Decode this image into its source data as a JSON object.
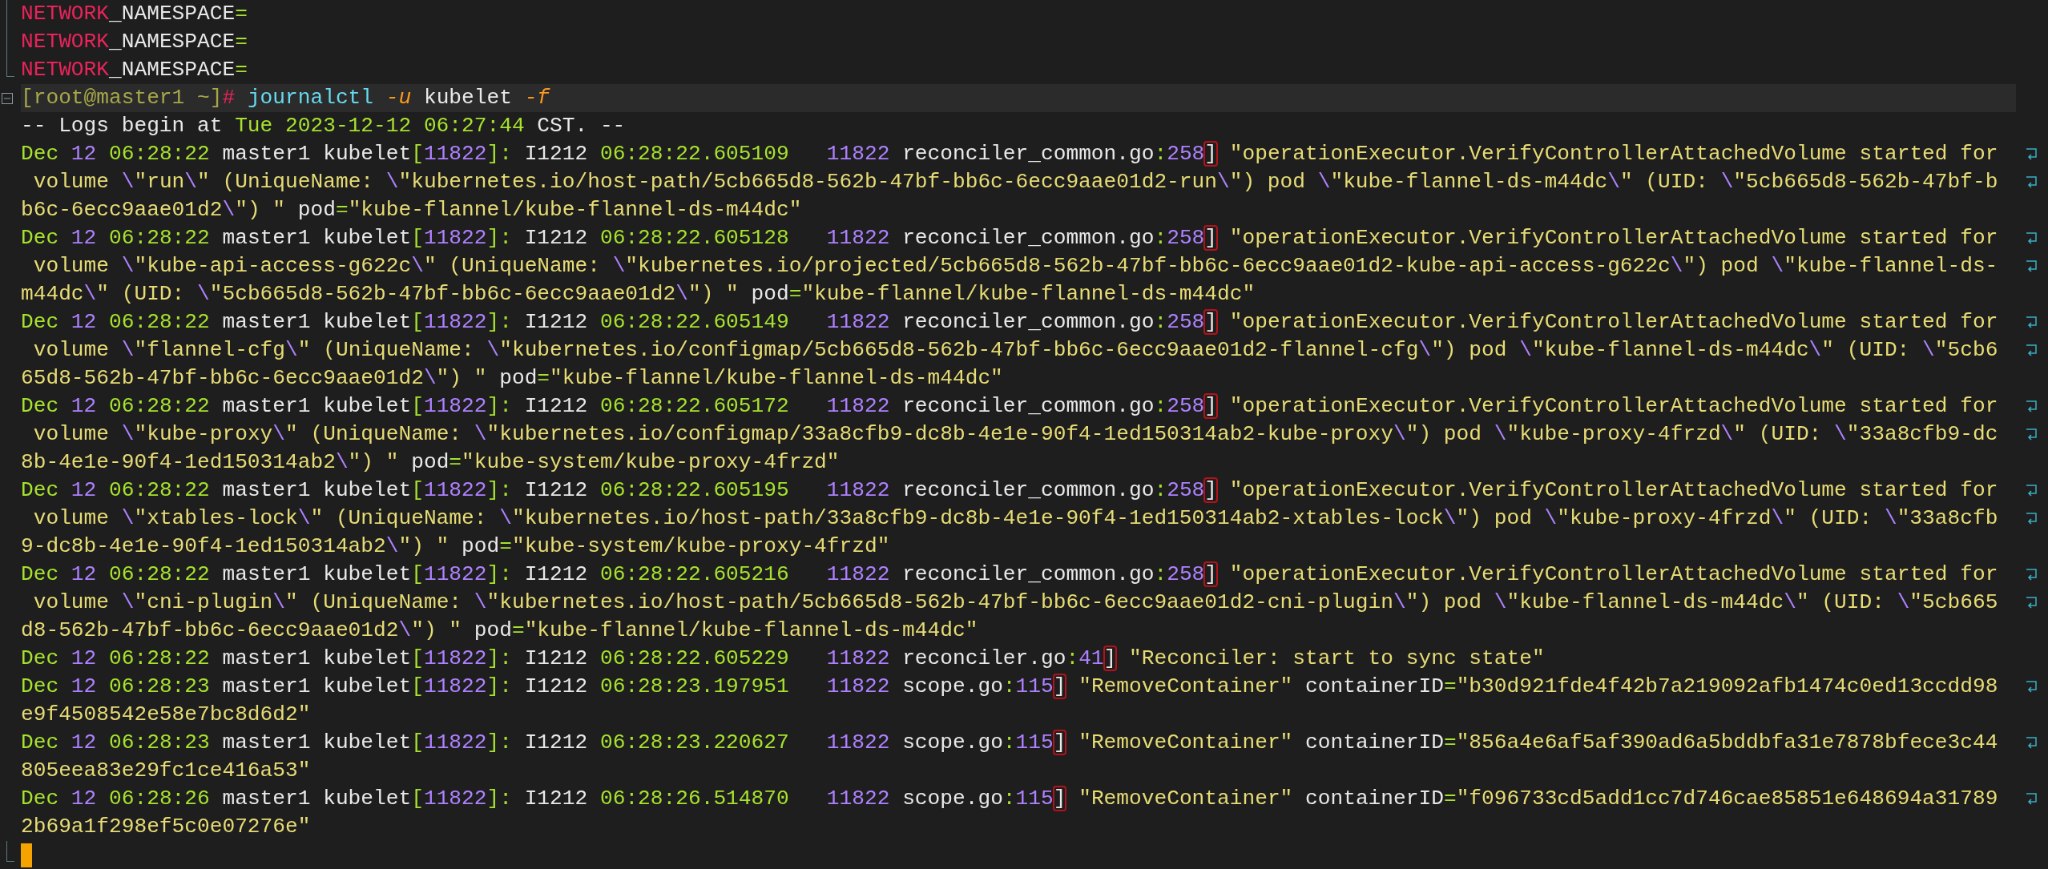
{
  "terminal": {
    "lines": [
      {
        "kind": "branch",
        "current": false,
        "wrapped": false,
        "segments": [
          {
            "kind": "keyword",
            "text": "NETWORK"
          },
          {
            "kind": "plain",
            "text": "_NAMESPACE"
          },
          {
            "kind": "punct",
            "text": "="
          }
        ]
      },
      {
        "kind": "branch",
        "current": false,
        "wrapped": false,
        "segments": [
          {
            "kind": "keyword",
            "text": "NETWORK"
          },
          {
            "kind": "plain",
            "text": "_NAMESPACE"
          },
          {
            "kind": "punct",
            "text": "="
          }
        ]
      },
      {
        "kind": "last",
        "current": false,
        "wrapped": false,
        "segments": [
          {
            "kind": "keyword",
            "text": "NETWORK"
          },
          {
            "kind": "plain",
            "text": "_NAMESPACE"
          },
          {
            "kind": "punct",
            "text": "="
          }
        ]
      },
      {
        "kind": "fold",
        "current": true,
        "wrapped": false,
        "segments": [
          {
            "kind": "prompt",
            "text": "[root@master1 ~]"
          },
          {
            "kind": "keyword",
            "text": "#"
          },
          {
            "kind": "command",
            "text": " journalctl"
          },
          {
            "kind": "flag",
            "text": " -u"
          },
          {
            "kind": "plain",
            "text": " kubelet"
          },
          {
            "kind": "flag",
            "text": " -f"
          }
        ]
      },
      {
        "current": false,
        "wrapped": false,
        "segments": [
          {
            "kind": "plain",
            "text": "-- Logs begin at "
          },
          {
            "kind": "time",
            "text": "Tue 2023-12-12 06:27:44"
          },
          {
            "kind": "plain",
            "text": " CST. --"
          }
        ]
      },
      {
        "current": false,
        "wrapped": true,
        "segments": [
          {
            "kind": "time",
            "text": "Dec"
          },
          {
            "kind": "number",
            "text": " 12"
          },
          {
            "kind": "time",
            "text": " 06:28:22"
          },
          {
            "kind": "plain",
            "text": " master1 kubelet"
          },
          {
            "kind": "punct",
            "text": "["
          },
          {
            "kind": "number",
            "text": "11822"
          },
          {
            "kind": "punct",
            "text": "]:"
          },
          {
            "kind": "plain",
            "text": " I1212 "
          },
          {
            "kind": "time",
            "text": "06:28:22.605109"
          },
          {
            "kind": "number",
            "text": "   11822"
          },
          {
            "kind": "plain",
            "text": " reconciler_common.go"
          },
          {
            "kind": "punct",
            "text": ":"
          },
          {
            "kind": "number",
            "text": "258"
          },
          {
            "kind": "match",
            "text": "]"
          },
          {
            "kind": "string",
            "text": " \"operationExecutor.VerifyControllerAttachedVolume started for"
          }
        ]
      },
      {
        "current": false,
        "wrapped": true,
        "segments": [
          {
            "kind": "string",
            "text": " volume "
          },
          {
            "kind": "escape",
            "text": "\\"
          },
          {
            "kind": "string",
            "text": "\"run"
          },
          {
            "kind": "escape",
            "text": "\\"
          },
          {
            "kind": "string",
            "text": "\" (UniqueName: "
          },
          {
            "kind": "escape",
            "text": "\\"
          },
          {
            "kind": "string",
            "text": "\"kubernetes.io/host-path/5cb665d8-562b-47bf-bb6c-6ecc9aae01d2-run"
          },
          {
            "kind": "escape",
            "text": "\\"
          },
          {
            "kind": "string",
            "text": "\") pod "
          },
          {
            "kind": "escape",
            "text": "\\"
          },
          {
            "kind": "string",
            "text": "\"kube-flannel-ds-m44dc"
          },
          {
            "kind": "escape",
            "text": "\\"
          },
          {
            "kind": "string",
            "text": "\" (UID: "
          },
          {
            "kind": "escape",
            "text": "\\"
          },
          {
            "kind": "string",
            "text": "\"5cb665d8-562b-47bf-b"
          }
        ]
      },
      {
        "current": false,
        "wrapped": false,
        "segments": [
          {
            "kind": "string",
            "text": "b6c-6ecc9aae01d2"
          },
          {
            "kind": "escape",
            "text": "\\"
          },
          {
            "kind": "string",
            "text": "\") \""
          },
          {
            "kind": "plain",
            "text": " pod"
          },
          {
            "kind": "punct",
            "text": "="
          },
          {
            "kind": "string",
            "text": "\"kube-flannel/kube-flannel-ds-m44dc\""
          }
        ]
      },
      {
        "current": false,
        "wrapped": true,
        "segments": [
          {
            "kind": "time",
            "text": "Dec"
          },
          {
            "kind": "number",
            "text": " 12"
          },
          {
            "kind": "time",
            "text": " 06:28:22"
          },
          {
            "kind": "plain",
            "text": " master1 kubelet"
          },
          {
            "kind": "punct",
            "text": "["
          },
          {
            "kind": "number",
            "text": "11822"
          },
          {
            "kind": "punct",
            "text": "]:"
          },
          {
            "kind": "plain",
            "text": " I1212 "
          },
          {
            "kind": "time",
            "text": "06:28:22.605128"
          },
          {
            "kind": "number",
            "text": "   11822"
          },
          {
            "kind": "plain",
            "text": " reconciler_common.go"
          },
          {
            "kind": "punct",
            "text": ":"
          },
          {
            "kind": "number",
            "text": "258"
          },
          {
            "kind": "match",
            "text": "]"
          },
          {
            "kind": "string",
            "text": " \"operationExecutor.VerifyControllerAttachedVolume started for"
          }
        ]
      },
      {
        "current": false,
        "wrapped": true,
        "segments": [
          {
            "kind": "string",
            "text": " volume "
          },
          {
            "kind": "escape",
            "text": "\\"
          },
          {
            "kind": "string",
            "text": "\"kube-api-access-g622c"
          },
          {
            "kind": "escape",
            "text": "\\"
          },
          {
            "kind": "string",
            "text": "\" (UniqueName: "
          },
          {
            "kind": "escape",
            "text": "\\"
          },
          {
            "kind": "string",
            "text": "\"kubernetes.io/projected/5cb665d8-562b-47bf-bb6c-6ecc9aae01d2-kube-api-access-g622c"
          },
          {
            "kind": "escape",
            "text": "\\"
          },
          {
            "kind": "string",
            "text": "\") pod "
          },
          {
            "kind": "escape",
            "text": "\\"
          },
          {
            "kind": "string",
            "text": "\"kube-flannel-ds-"
          }
        ]
      },
      {
        "current": false,
        "wrapped": false,
        "segments": [
          {
            "kind": "string",
            "text": "m44dc"
          },
          {
            "kind": "escape",
            "text": "\\"
          },
          {
            "kind": "string",
            "text": "\" (UID: "
          },
          {
            "kind": "escape",
            "text": "\\"
          },
          {
            "kind": "string",
            "text": "\"5cb665d8-562b-47bf-bb6c-6ecc9aae01d2"
          },
          {
            "kind": "escape",
            "text": "\\"
          },
          {
            "kind": "string",
            "text": "\") \""
          },
          {
            "kind": "plain",
            "text": " pod"
          },
          {
            "kind": "punct",
            "text": "="
          },
          {
            "kind": "string",
            "text": "\"kube-flannel/kube-flannel-ds-m44dc\""
          }
        ]
      },
      {
        "current": false,
        "wrapped": true,
        "segments": [
          {
            "kind": "time",
            "text": "Dec"
          },
          {
            "kind": "number",
            "text": " 12"
          },
          {
            "kind": "time",
            "text": " 06:28:22"
          },
          {
            "kind": "plain",
            "text": " master1 kubelet"
          },
          {
            "kind": "punct",
            "text": "["
          },
          {
            "kind": "number",
            "text": "11822"
          },
          {
            "kind": "punct",
            "text": "]:"
          },
          {
            "kind": "plain",
            "text": " I1212 "
          },
          {
            "kind": "time",
            "text": "06:28:22.605149"
          },
          {
            "kind": "number",
            "text": "   11822"
          },
          {
            "kind": "plain",
            "text": " reconciler_common.go"
          },
          {
            "kind": "punct",
            "text": ":"
          },
          {
            "kind": "number",
            "text": "258"
          },
          {
            "kind": "match",
            "text": "]"
          },
          {
            "kind": "string",
            "text": " \"operationExecutor.VerifyControllerAttachedVolume started for"
          }
        ]
      },
      {
        "current": false,
        "wrapped": true,
        "segments": [
          {
            "kind": "string",
            "text": " volume "
          },
          {
            "kind": "escape",
            "text": "\\"
          },
          {
            "kind": "string",
            "text": "\"flannel-cfg"
          },
          {
            "kind": "escape",
            "text": "\\"
          },
          {
            "kind": "string",
            "text": "\" (UniqueName: "
          },
          {
            "kind": "escape",
            "text": "\\"
          },
          {
            "kind": "string",
            "text": "\"kubernetes.io/configmap/5cb665d8-562b-47bf-bb6c-6ecc9aae01d2-flannel-cfg"
          },
          {
            "kind": "escape",
            "text": "\\"
          },
          {
            "kind": "string",
            "text": "\") pod "
          },
          {
            "kind": "escape",
            "text": "\\"
          },
          {
            "kind": "string",
            "text": "\"kube-flannel-ds-m44dc"
          },
          {
            "kind": "escape",
            "text": "\\"
          },
          {
            "kind": "string",
            "text": "\" (UID: "
          },
          {
            "kind": "escape",
            "text": "\\"
          },
          {
            "kind": "string",
            "text": "\"5cb6"
          }
        ]
      },
      {
        "current": false,
        "wrapped": false,
        "segments": [
          {
            "kind": "string",
            "text": "65d8-562b-47bf-bb6c-6ecc9aae01d2"
          },
          {
            "kind": "escape",
            "text": "\\"
          },
          {
            "kind": "string",
            "text": "\") \""
          },
          {
            "kind": "plain",
            "text": " pod"
          },
          {
            "kind": "punct",
            "text": "="
          },
          {
            "kind": "string",
            "text": "\"kube-flannel/kube-flannel-ds-m44dc\""
          }
        ]
      },
      {
        "current": false,
        "wrapped": true,
        "segments": [
          {
            "kind": "time",
            "text": "Dec"
          },
          {
            "kind": "number",
            "text": " 12"
          },
          {
            "kind": "time",
            "text": " 06:28:22"
          },
          {
            "kind": "plain",
            "text": " master1 kubelet"
          },
          {
            "kind": "punct",
            "text": "["
          },
          {
            "kind": "number",
            "text": "11822"
          },
          {
            "kind": "punct",
            "text": "]:"
          },
          {
            "kind": "plain",
            "text": " I1212 "
          },
          {
            "kind": "time",
            "text": "06:28:22.605172"
          },
          {
            "kind": "number",
            "text": "   11822"
          },
          {
            "kind": "plain",
            "text": " reconciler_common.go"
          },
          {
            "kind": "punct",
            "text": ":"
          },
          {
            "kind": "number",
            "text": "258"
          },
          {
            "kind": "match",
            "text": "]"
          },
          {
            "kind": "string",
            "text": " \"operationExecutor.VerifyControllerAttachedVolume started for"
          }
        ]
      },
      {
        "current": false,
        "wrapped": true,
        "segments": [
          {
            "kind": "string",
            "text": " volume "
          },
          {
            "kind": "escape",
            "text": "\\"
          },
          {
            "kind": "string",
            "text": "\"kube-proxy"
          },
          {
            "kind": "escape",
            "text": "\\"
          },
          {
            "kind": "string",
            "text": "\" (UniqueName: "
          },
          {
            "kind": "escape",
            "text": "\\"
          },
          {
            "kind": "string",
            "text": "\"kubernetes.io/configmap/33a8cfb9-dc8b-4e1e-90f4-1ed150314ab2-kube-proxy"
          },
          {
            "kind": "escape",
            "text": "\\"
          },
          {
            "kind": "string",
            "text": "\") pod "
          },
          {
            "kind": "escape",
            "text": "\\"
          },
          {
            "kind": "string",
            "text": "\"kube-proxy-4frzd"
          },
          {
            "kind": "escape",
            "text": "\\"
          },
          {
            "kind": "string",
            "text": "\" (UID: "
          },
          {
            "kind": "escape",
            "text": "\\"
          },
          {
            "kind": "string",
            "text": "\"33a8cfb9-dc"
          }
        ]
      },
      {
        "current": false,
        "wrapped": false,
        "segments": [
          {
            "kind": "string",
            "text": "8b-4e1e-90f4-1ed150314ab2"
          },
          {
            "kind": "escape",
            "text": "\\"
          },
          {
            "kind": "string",
            "text": "\") \""
          },
          {
            "kind": "plain",
            "text": " pod"
          },
          {
            "kind": "punct",
            "text": "="
          },
          {
            "kind": "string",
            "text": "\"kube-system/kube-proxy-4frzd\""
          }
        ]
      },
      {
        "current": false,
        "wrapped": true,
        "segments": [
          {
            "kind": "time",
            "text": "Dec"
          },
          {
            "kind": "number",
            "text": " 12"
          },
          {
            "kind": "time",
            "text": " 06:28:22"
          },
          {
            "kind": "plain",
            "text": " master1 kubelet"
          },
          {
            "kind": "punct",
            "text": "["
          },
          {
            "kind": "number",
            "text": "11822"
          },
          {
            "kind": "punct",
            "text": "]:"
          },
          {
            "kind": "plain",
            "text": " I1212 "
          },
          {
            "kind": "time",
            "text": "06:28:22.605195"
          },
          {
            "kind": "number",
            "text": "   11822"
          },
          {
            "kind": "plain",
            "text": " reconciler_common.go"
          },
          {
            "kind": "punct",
            "text": ":"
          },
          {
            "kind": "number",
            "text": "258"
          },
          {
            "kind": "match",
            "text": "]"
          },
          {
            "kind": "string",
            "text": " \"operationExecutor.VerifyControllerAttachedVolume started for"
          }
        ]
      },
      {
        "current": false,
        "wrapped": true,
        "segments": [
          {
            "kind": "string",
            "text": " volume "
          },
          {
            "kind": "escape",
            "text": "\\"
          },
          {
            "kind": "string",
            "text": "\"xtables-lock"
          },
          {
            "kind": "escape",
            "text": "\\"
          },
          {
            "kind": "string",
            "text": "\" (UniqueName: "
          },
          {
            "kind": "escape",
            "text": "\\"
          },
          {
            "kind": "string",
            "text": "\"kubernetes.io/host-path/33a8cfb9-dc8b-4e1e-90f4-1ed150314ab2-xtables-lock"
          },
          {
            "kind": "escape",
            "text": "\\"
          },
          {
            "kind": "string",
            "text": "\") pod "
          },
          {
            "kind": "escape",
            "text": "\\"
          },
          {
            "kind": "string",
            "text": "\"kube-proxy-4frzd"
          },
          {
            "kind": "escape",
            "text": "\\"
          },
          {
            "kind": "string",
            "text": "\" (UID: "
          },
          {
            "kind": "escape",
            "text": "\\"
          },
          {
            "kind": "string",
            "text": "\"33a8cfb"
          }
        ]
      },
      {
        "current": false,
        "wrapped": false,
        "segments": [
          {
            "kind": "string",
            "text": "9-dc8b-4e1e-90f4-1ed150314ab2"
          },
          {
            "kind": "escape",
            "text": "\\"
          },
          {
            "kind": "string",
            "text": "\") \""
          },
          {
            "kind": "plain",
            "text": " pod"
          },
          {
            "kind": "punct",
            "text": "="
          },
          {
            "kind": "string",
            "text": "\"kube-system/kube-proxy-4frzd\""
          }
        ]
      },
      {
        "current": false,
        "wrapped": true,
        "segments": [
          {
            "kind": "time",
            "text": "Dec"
          },
          {
            "kind": "number",
            "text": " 12"
          },
          {
            "kind": "time",
            "text": " 06:28:22"
          },
          {
            "kind": "plain",
            "text": " master1 kubelet"
          },
          {
            "kind": "punct",
            "text": "["
          },
          {
            "kind": "number",
            "text": "11822"
          },
          {
            "kind": "punct",
            "text": "]:"
          },
          {
            "kind": "plain",
            "text": " I1212 "
          },
          {
            "kind": "time",
            "text": "06:28:22.605216"
          },
          {
            "kind": "number",
            "text": "   11822"
          },
          {
            "kind": "plain",
            "text": " reconciler_common.go"
          },
          {
            "kind": "punct",
            "text": ":"
          },
          {
            "kind": "number",
            "text": "258"
          },
          {
            "kind": "match",
            "text": "]"
          },
          {
            "kind": "string",
            "text": " \"operationExecutor.VerifyControllerAttachedVolume started for"
          }
        ]
      },
      {
        "current": false,
        "wrapped": true,
        "segments": [
          {
            "kind": "string",
            "text": " volume "
          },
          {
            "kind": "escape",
            "text": "\\"
          },
          {
            "kind": "string",
            "text": "\"cni-plugin"
          },
          {
            "kind": "escape",
            "text": "\\"
          },
          {
            "kind": "string",
            "text": "\" (UniqueName: "
          },
          {
            "kind": "escape",
            "text": "\\"
          },
          {
            "kind": "string",
            "text": "\"kubernetes.io/host-path/5cb665d8-562b-47bf-bb6c-6ecc9aae01d2-cni-plugin"
          },
          {
            "kind": "escape",
            "text": "\\"
          },
          {
            "kind": "string",
            "text": "\") pod "
          },
          {
            "kind": "escape",
            "text": "\\"
          },
          {
            "kind": "string",
            "text": "\"kube-flannel-ds-m44dc"
          },
          {
            "kind": "escape",
            "text": "\\"
          },
          {
            "kind": "string",
            "text": "\" (UID: "
          },
          {
            "kind": "escape",
            "text": "\\"
          },
          {
            "kind": "string",
            "text": "\"5cb665"
          }
        ]
      },
      {
        "current": false,
        "wrapped": false,
        "segments": [
          {
            "kind": "string",
            "text": "d8-562b-47bf-bb6c-6ecc9aae01d2"
          },
          {
            "kind": "escape",
            "text": "\\"
          },
          {
            "kind": "string",
            "text": "\") \""
          },
          {
            "kind": "plain",
            "text": " pod"
          },
          {
            "kind": "punct",
            "text": "="
          },
          {
            "kind": "string",
            "text": "\"kube-flannel/kube-flannel-ds-m44dc\""
          }
        ]
      },
      {
        "current": false,
        "wrapped": false,
        "segments": [
          {
            "kind": "time",
            "text": "Dec"
          },
          {
            "kind": "number",
            "text": " 12"
          },
          {
            "kind": "time",
            "text": " 06:28:22"
          },
          {
            "kind": "plain",
            "text": " master1 kubelet"
          },
          {
            "kind": "punct",
            "text": "["
          },
          {
            "kind": "number",
            "text": "11822"
          },
          {
            "kind": "punct",
            "text": "]:"
          },
          {
            "kind": "plain",
            "text": " I1212 "
          },
          {
            "kind": "time",
            "text": "06:28:22.605229"
          },
          {
            "kind": "number",
            "text": "   11822"
          },
          {
            "kind": "plain",
            "text": " reconciler.go"
          },
          {
            "kind": "punct",
            "text": ":"
          },
          {
            "kind": "number",
            "text": "41"
          },
          {
            "kind": "match",
            "text": "]"
          },
          {
            "kind": "string",
            "text": " \"Reconciler: start to sync state\""
          }
        ]
      },
      {
        "current": false,
        "wrapped": true,
        "segments": [
          {
            "kind": "time",
            "text": "Dec"
          },
          {
            "kind": "number",
            "text": " 12"
          },
          {
            "kind": "time",
            "text": " 06:28:23"
          },
          {
            "kind": "plain",
            "text": " master1 kubelet"
          },
          {
            "kind": "punct",
            "text": "["
          },
          {
            "kind": "number",
            "text": "11822"
          },
          {
            "kind": "punct",
            "text": "]:"
          },
          {
            "kind": "plain",
            "text": " I1212 "
          },
          {
            "kind": "time",
            "text": "06:28:23.197951"
          },
          {
            "kind": "number",
            "text": "   11822"
          },
          {
            "kind": "plain",
            "text": " scope.go"
          },
          {
            "kind": "punct",
            "text": ":"
          },
          {
            "kind": "number",
            "text": "115"
          },
          {
            "kind": "match",
            "text": "]"
          },
          {
            "kind": "string",
            "text": " \"RemoveContainer\""
          },
          {
            "kind": "plain",
            "text": " containerID"
          },
          {
            "kind": "punct",
            "text": "="
          },
          {
            "kind": "string",
            "text": "\"b30d921fde4f42b7a219092afb1474c0ed13ccdd98"
          }
        ]
      },
      {
        "current": false,
        "wrapped": false,
        "segments": [
          {
            "kind": "string",
            "text": "e9f4508542e58e7bc8d6d2\""
          }
        ]
      },
      {
        "current": false,
        "wrapped": true,
        "segments": [
          {
            "kind": "time",
            "text": "Dec"
          },
          {
            "kind": "number",
            "text": " 12"
          },
          {
            "kind": "time",
            "text": " 06:28:23"
          },
          {
            "kind": "plain",
            "text": " master1 kubelet"
          },
          {
            "kind": "punct",
            "text": "["
          },
          {
            "kind": "number",
            "text": "11822"
          },
          {
            "kind": "punct",
            "text": "]:"
          },
          {
            "kind": "plain",
            "text": " I1212 "
          },
          {
            "kind": "time",
            "text": "06:28:23.220627"
          },
          {
            "kind": "number",
            "text": "   11822"
          },
          {
            "kind": "plain",
            "text": " scope.go"
          },
          {
            "kind": "punct",
            "text": ":"
          },
          {
            "kind": "number",
            "text": "115"
          },
          {
            "kind": "match",
            "text": "]"
          },
          {
            "kind": "string",
            "text": " \"RemoveContainer\""
          },
          {
            "kind": "plain",
            "text": " containerID"
          },
          {
            "kind": "punct",
            "text": "="
          },
          {
            "kind": "string",
            "text": "\"856a4e6af5af390ad6a5bddbfa31e7878bfece3c44"
          }
        ]
      },
      {
        "current": false,
        "wrapped": false,
        "segments": [
          {
            "kind": "string",
            "text": "805eea83e29fc1ce416a53\""
          }
        ]
      },
      {
        "current": false,
        "wrapped": true,
        "segments": [
          {
            "kind": "time",
            "text": "Dec"
          },
          {
            "kind": "number",
            "text": " 12"
          },
          {
            "kind": "time",
            "text": " 06:28:26"
          },
          {
            "kind": "plain",
            "text": " master1 kubelet"
          },
          {
            "kind": "punct",
            "text": "["
          },
          {
            "kind": "number",
            "text": "11822"
          },
          {
            "kind": "punct",
            "text": "]:"
          },
          {
            "kind": "plain",
            "text": " I1212 "
          },
          {
            "kind": "time",
            "text": "06:28:26.514870"
          },
          {
            "kind": "number",
            "text": "   11822"
          },
          {
            "kind": "plain",
            "text": " scope.go"
          },
          {
            "kind": "punct",
            "text": ":"
          },
          {
            "kind": "number",
            "text": "115"
          },
          {
            "kind": "match",
            "text": "]"
          },
          {
            "kind": "string",
            "text": " \"RemoveContainer\""
          },
          {
            "kind": "plain",
            "text": " containerID"
          },
          {
            "kind": "punct",
            "text": "="
          },
          {
            "kind": "string",
            "text": "\"f096733cd5add1cc7d746cae85851e648694a31789"
          }
        ]
      },
      {
        "current": false,
        "wrapped": false,
        "segments": [
          {
            "kind": "string",
            "text": "2b69a1f298ef5c0e07276e\""
          }
        ]
      }
    ],
    "cursor": {
      "visible": true,
      "kind": "last"
    }
  }
}
